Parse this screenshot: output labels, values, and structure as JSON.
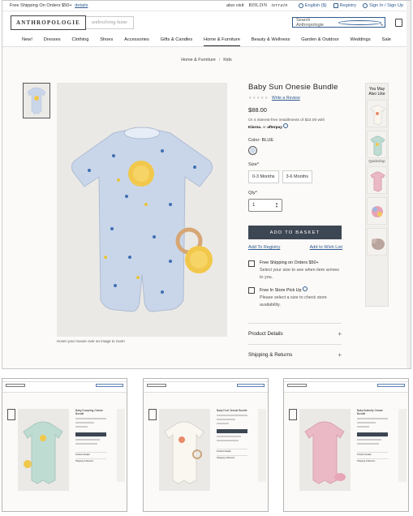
{
  "topbar": {
    "shipping": "Free Shipping On Orders $50+",
    "details": "details",
    "also_visit": "also visit",
    "bhldn": "BHLDN",
    "terrain": "terrain",
    "language": "English ($)",
    "registry": "Registry",
    "signin": "Sign In / Sign Up"
  },
  "header": {
    "logo": "ANTHROPOLOGIE",
    "logo2": "anthroliving home",
    "search_placeholder": "Search Anthropologie"
  },
  "nav": [
    "New!",
    "Dresses",
    "Clothing",
    "Shoes",
    "Accessories",
    "Gifts & Candles",
    "Home & Furniture",
    "Beauty & Wellness",
    "Garden & Outdoor",
    "Weddings",
    "Sale"
  ],
  "breadcrumb": [
    "Home & Furniture",
    "Kids"
  ],
  "product": {
    "title": "Baby Sun Onesie Bundle",
    "stars": "★★★★★",
    "review_link": "Write a Review",
    "price": "$88.00",
    "installments": "Or 4 interest-free installments of $22.00 with",
    "klarna": "Klarna.",
    "or": "or",
    "afterpay": "afterpay",
    "color_label": "Color: BLUE",
    "size_label": "Size*",
    "sizes": [
      "0-3 Months",
      "3-6 Months"
    ],
    "qty_label": "Qty*",
    "qty_value": "1",
    "add_to_basket": "ADD TO BASKET",
    "add_to_registry": "Add To Registry",
    "add_to_wishlist": "Add to Wish List",
    "ship_title": "Free Shipping on Orders $50+",
    "ship_text": "Select your size to see when item arrives to you.",
    "pickup_title": "Free In Store Pick Up",
    "pickup_text": "Please select a size to check store availability.",
    "details_label": "Product Details",
    "shipping_returns_label": "Shipping & Returns",
    "zoom_note": "Hover your mouse over an image to zoom"
  },
  "ymal": {
    "heading": "You May Also Like",
    "quickshop": "Quickshop"
  },
  "small_shots": [
    {
      "title": "Baby Dumpling Onesie Bundle",
      "accent": "#bfdcd3"
    },
    {
      "title": "Baby Fruit Onesie Bundle",
      "accent": "#f2f0ec"
    },
    {
      "title": "Baby Butterfly Onesie Bundle",
      "accent": "#eab9c5"
    }
  ],
  "small_shot_labels": {
    "details": "Product Details",
    "shipping": "Shipping & Returns"
  },
  "colors": {
    "accent_blue": "#2f5a8f",
    "button_dark": "#3d4653",
    "onesie_blue": "#c9d6ea",
    "sun_yellow": "#f1c84b"
  }
}
